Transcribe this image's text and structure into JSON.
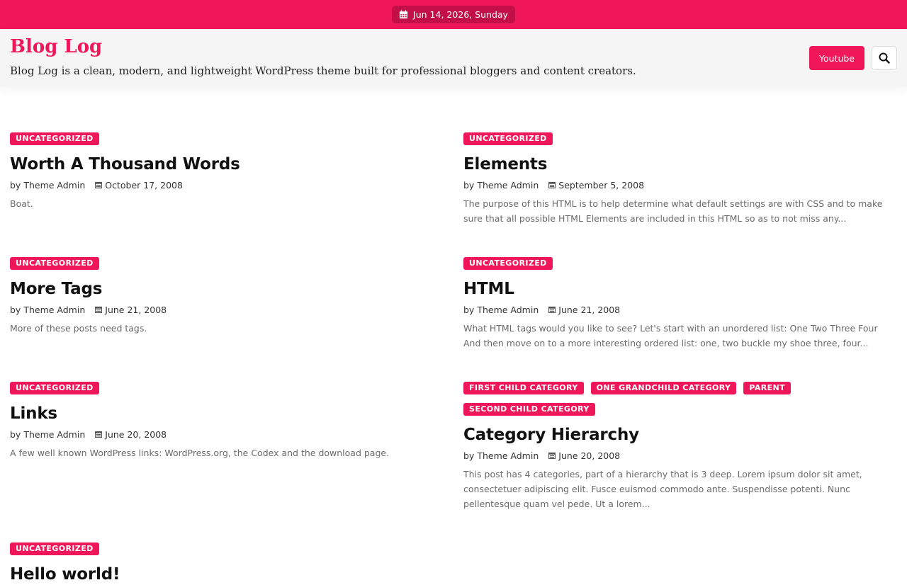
{
  "topbar": {
    "date": "Jun 14, 2026, Sunday"
  },
  "header": {
    "title": "Blog Log",
    "description": "Blog Log is a clean, modern, and lightweight WordPress theme built for professional bloggers and content creators.",
    "youtube_label": "Youtube"
  },
  "posts": [
    {
      "categories": [
        "UNCATEGORIZED"
      ],
      "title": "Worth A Thousand Words",
      "by": "by",
      "author": "Theme Admin",
      "date": "October 17, 2008",
      "excerpt": "Boat."
    },
    {
      "categories": [
        "UNCATEGORIZED"
      ],
      "title": "Elements",
      "by": "by",
      "author": "Theme Admin",
      "date": "September 5, 2008",
      "excerpt": "The purpose of this HTML is to help determine what default settings are with CSS and to make sure that all possible HTML Elements are included in this HTML so as to not miss any..."
    },
    {
      "categories": [
        "UNCATEGORIZED"
      ],
      "title": "More Tags",
      "by": "by",
      "author": "Theme Admin",
      "date": "June 21, 2008",
      "excerpt": "More of these posts need tags."
    },
    {
      "categories": [
        "UNCATEGORIZED"
      ],
      "title": "HTML",
      "by": "by",
      "author": "Theme Admin",
      "date": "June 21, 2008",
      "excerpt": "What HTML tags would you like to see? Let's start with an unordered list: One Two Three Four And then move on to a more interesting ordered list: one, two buckle my shoe three, four..."
    },
    {
      "categories": [
        "UNCATEGORIZED"
      ],
      "title": "Links",
      "by": "by",
      "author": "Theme Admin",
      "date": "June 20, 2008",
      "excerpt": "A few well known WordPress links: WordPress.org, the Codex and the download page."
    },
    {
      "categories": [
        "FIRST CHILD CATEGORY",
        "ONE GRANDCHILD CATEGORY",
        "PARENT",
        "SECOND CHILD CATEGORY"
      ],
      "title": "Category Hierarchy",
      "by": "by",
      "author": "Theme Admin",
      "date": "June 20, 2008",
      "excerpt": "This post has 4 categories, part of a hierarchy that is 3 deep. Lorem ipsum dolor sit amet, consectetuer adipiscing elit. Fusce euismod commodo ante. Suspendisse potenti. Nunc pellentesque quam vel pede. Ut a lorem..."
    },
    {
      "categories": [
        "UNCATEGORIZED"
      ],
      "title": "Hello world!",
      "by": "",
      "author": "",
      "date": "",
      "excerpt": ""
    }
  ]
}
